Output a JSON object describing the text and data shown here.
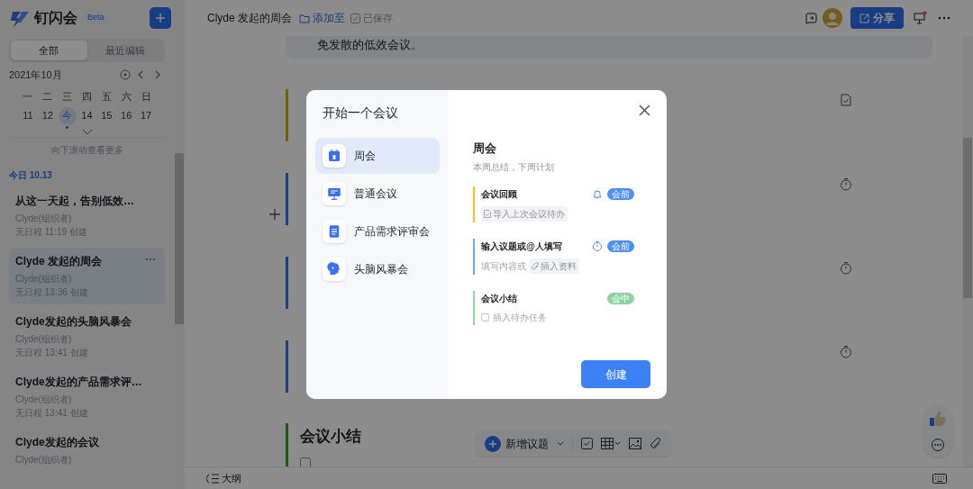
{
  "app": {
    "name": "钉闪会",
    "badge": "Beta"
  },
  "sidebar": {
    "tabs": [
      {
        "label": "全部",
        "selected": true
      },
      {
        "label": "最近编辑",
        "selected": false
      }
    ],
    "calendar": {
      "month": "2021年10月",
      "weekdays": [
        "一",
        "二",
        "三",
        "四",
        "五",
        "六",
        "日"
      ],
      "days": [
        {
          "label": "11",
          "selected": false
        },
        {
          "label": "12",
          "selected": false
        },
        {
          "label": "今",
          "selected": true
        },
        {
          "label": "14",
          "selected": false
        },
        {
          "label": "15",
          "selected": false
        },
        {
          "label": "16",
          "selected": false
        },
        {
          "label": "17",
          "selected": false
        }
      ]
    },
    "scroll_hint": "向下滚动查看更多",
    "date_header": "今日 10.13",
    "meetings": [
      {
        "title": "从这一天起，告别低效…",
        "organizer": "Clyde(组织者)",
        "meta": "无日程 11:19 创建",
        "selected": false
      },
      {
        "title": "Clyde 发起的周会",
        "organizer": "Clyde(组织者)",
        "meta": "无日程 13:36 创建",
        "selected": true
      },
      {
        "title": "Clyde发起的头脑风暴会",
        "organizer": "Clyde(组织者)",
        "meta": "无日程 13:41 创建",
        "selected": false
      },
      {
        "title": "Clyde发起的产品需求评…",
        "organizer": "Clyde(组织者)",
        "meta": "无日程 13:41 创建",
        "selected": false
      },
      {
        "title": "Clyde发起的会议",
        "organizer": "Clyde(组织者)",
        "selected": false
      }
    ]
  },
  "header": {
    "title": "Clyde 发起的周会",
    "add_to": "添加至",
    "saved": "已保存",
    "share": "分享"
  },
  "document": {
    "intro": "免发散的低效会议。",
    "sections": [
      {
        "color": "#756103",
        "kind": "doc"
      },
      {
        "color": "#223d7b",
        "kind": "timer"
      },
      {
        "color": "#223d7b",
        "kind": "timer"
      },
      {
        "color": "#223d7b",
        "kind": "timer"
      }
    ],
    "summary": {
      "color": "#235520",
      "heading": "会议小结",
      "checked": false
    }
  },
  "toolbar": {
    "add": "新增议题"
  },
  "bottom_bar": {
    "outline": "大纲"
  },
  "modal": {
    "title": "开始一个会议",
    "templates": [
      {
        "label": "周会",
        "kind": "calendar",
        "selected": true
      },
      {
        "label": "普通会议",
        "kind": "screen",
        "selected": false
      },
      {
        "label": "产品需求评审会",
        "kind": "doc",
        "selected": false
      },
      {
        "label": "头脑风暴会",
        "kind": "head",
        "selected": false
      }
    ],
    "detail": {
      "title": "周会",
      "subtitle": "本周总结，下周计划",
      "agenda": [
        {
          "title": "会议回顾",
          "color": "#f5c518",
          "kind": "bell",
          "tag": {
            "text": "会前",
            "color": "#4d8ef7"
          },
          "action": {
            "kind": "import",
            "text": "导入上次会议待办"
          }
        },
        {
          "title": "输入议题或@人填写",
          "color": "#6fa3ff",
          "kind": "timer",
          "tag": {
            "text": "会前",
            "color": "#4d8ef7"
          },
          "hint": "填写内容或",
          "action": {
            "kind": "attach",
            "text": "插入资料"
          }
        },
        {
          "title": "会议小结",
          "color": "#8fd89a",
          "kind": "plain",
          "tag": {
            "text": "会中",
            "color": "#8fd4a0"
          },
          "action": {
            "kind": "checkbox",
            "text": "插入待办任务"
          }
        }
      ]
    },
    "create": "创建"
  }
}
